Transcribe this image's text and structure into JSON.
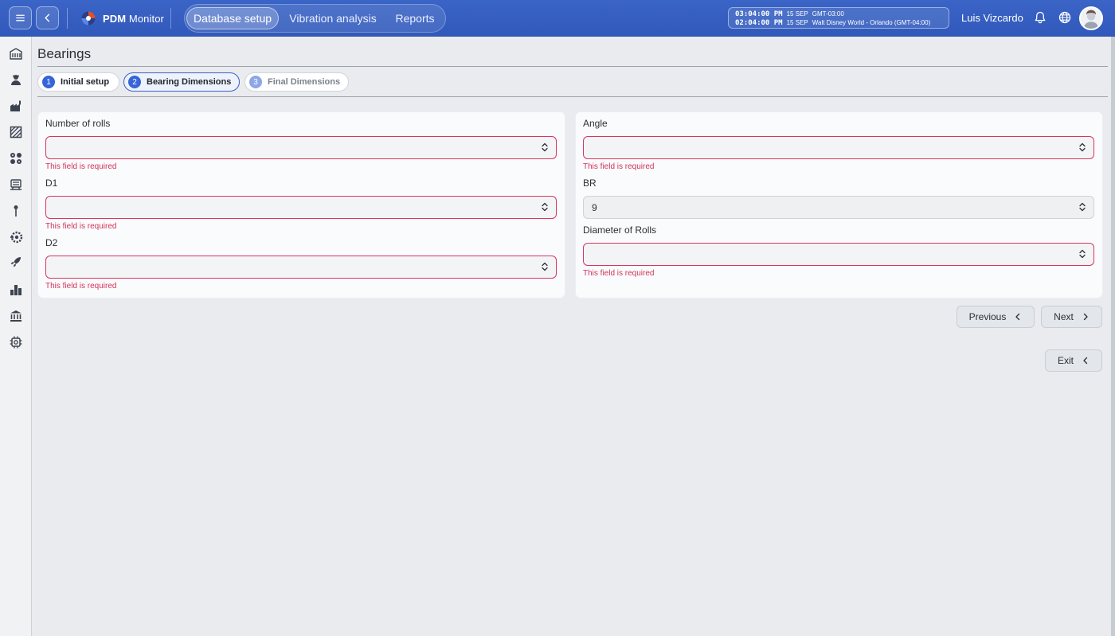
{
  "app": {
    "brand_bold": "PDM",
    "brand_rest": " Monitor"
  },
  "nav": {
    "tabs": [
      {
        "label": "Database setup",
        "active": true
      },
      {
        "label": "Vibration analysis",
        "active": false
      },
      {
        "label": "Reports",
        "active": false
      }
    ]
  },
  "clocks": [
    {
      "time": "03:04:00 PM",
      "date": "15 SEP",
      "zone": "GMT-03:00"
    },
    {
      "time": "02:04:00 PM",
      "date": "15 SEP",
      "zone": "Walt Disney World - Orlando (GMT-04:00)"
    }
  ],
  "user": {
    "name": "Luis Vizcardo"
  },
  "sidebar": {
    "icons": [
      "building-icon",
      "operator-icon",
      "factory-icon",
      "area-icon",
      "machines-icon",
      "equipment-icon",
      "sensor-point-icon",
      "gears-icon",
      "rocket-icon",
      "bar-chart-icon",
      "institution-icon",
      "chip-icon"
    ]
  },
  "page": {
    "title": "Bearings"
  },
  "steps": [
    {
      "number": "1",
      "label": "Initial setup",
      "state": "done"
    },
    {
      "number": "2",
      "label": "Bearing Dimensions",
      "state": "active"
    },
    {
      "number": "3",
      "label": "Final Dimensions",
      "state": "disabled"
    }
  ],
  "form": {
    "left": [
      {
        "label": "Number of rolls",
        "value": "",
        "error": "This field is required"
      },
      {
        "label": "D1",
        "value": "",
        "error": "This field is required"
      },
      {
        "label": "D2",
        "value": "",
        "error": "This field is required"
      }
    ],
    "right": [
      {
        "label": "Angle",
        "value": "",
        "error": "This field is required"
      },
      {
        "label": "BR",
        "value": "9",
        "error": ""
      },
      {
        "label": "Diameter of Rolls",
        "value": "",
        "error": "This field is required"
      }
    ]
  },
  "buttons": {
    "previous": "Previous",
    "next": "Next",
    "exit": "Exit"
  },
  "colors": {
    "topbar": "#3159bb",
    "accent": "#3565d8",
    "error": "#d0335a"
  }
}
